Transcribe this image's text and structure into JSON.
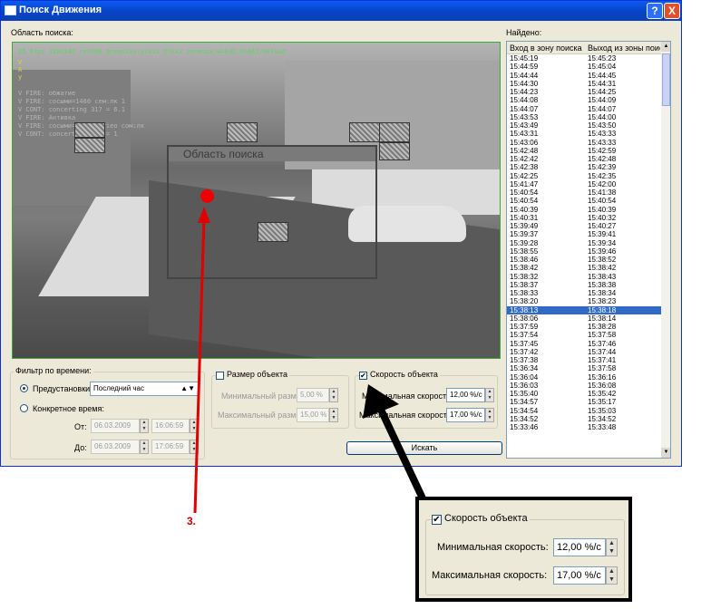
{
  "window": {
    "title": "Поиск Движения",
    "help": "?",
    "close": "X"
  },
  "search_area_label": "Область поиска:",
  "found_label": "Найдено:",
  "video": {
    "osd_top": "25.0fps 320x240 rot=90 area=xxx:y=xxx h=xxx zone=zx:w=632:h=462/deluxe",
    "osd_left": [
      "V",
      "A",
      "y",
      "",
      "V FIRE: обжатие",
      "V FIRE: сосыми=1460 сем:лк 1",
      "V CONT: concerting 317 = 6.1",
      "V FIRE: Антивка",
      "V FIRE: сосыми=6 eescerieo сом:лк",
      "V CONT: concerting 500 = 1"
    ],
    "zone_title": "Область поиска",
    "marker_number": "3."
  },
  "time_filter": {
    "title": "Фильтр по времени:",
    "presets_label": "Предустановки:",
    "presets_value": "Последний час",
    "specific_label": "Конкретное время:",
    "from_label": "От:",
    "to_label": "До:",
    "from_date": "06.03.2009",
    "from_time": "16:06:59",
    "to_date": "06.03.2009",
    "to_time": "17:06:59"
  },
  "size_filter": {
    "title": "Размер объекта",
    "min_label": "Минимальный размер:",
    "min_value": "5,00 %",
    "max_label": "Максимальный размер:",
    "max_value": "15,00 %"
  },
  "speed_filter": {
    "title": "Скорость объекта",
    "min_label": "Минимальная скорость:",
    "min_value": "12,00 %/с",
    "max_label": "Максимальная скорость:",
    "max_value": "17,00 %/с",
    "checked_glyph": "✔"
  },
  "search_button": "Искать",
  "results": {
    "col_enter": "Вход в зону поиска",
    "col_exit": "Выход из зоны поиск",
    "selected_index": 30,
    "rows": [
      [
        "15:45:19",
        "15:45:23"
      ],
      [
        "15:44:59",
        "15:45:04"
      ],
      [
        "15:44:44",
        "15:44:45"
      ],
      [
        "15:44:30",
        "15:44:31"
      ],
      [
        "15:44:23",
        "15:44:25"
      ],
      [
        "15:44:08",
        "15:44:09"
      ],
      [
        "15:44:07",
        "15:44:07"
      ],
      [
        "15:43:53",
        "15:44:00"
      ],
      [
        "15:43:49",
        "15:43:50"
      ],
      [
        "15:43:31",
        "15:43:33"
      ],
      [
        "15:43:06",
        "15:43:33"
      ],
      [
        "15:42:48",
        "15:42:59"
      ],
      [
        "15:42:42",
        "15:42:48"
      ],
      [
        "15:42:38",
        "15:42:39"
      ],
      [
        "15:42:25",
        "15:42:35"
      ],
      [
        "15:41:47",
        "15:42:00"
      ],
      [
        "15:40:54",
        "15:41:38"
      ],
      [
        "15:40:54",
        "15:40:54"
      ],
      [
        "15:40:39",
        "15:40:39"
      ],
      [
        "15:40:31",
        "15:40:32"
      ],
      [
        "15:39:49",
        "15:40:27"
      ],
      [
        "15:39:37",
        "15:39:41"
      ],
      [
        "15:39:28",
        "15:39:34"
      ],
      [
        "15:38:55",
        "15:39:46"
      ],
      [
        "15:38:46",
        "15:38:52"
      ],
      [
        "15:38:42",
        "15:38:42"
      ],
      [
        "15:38:32",
        "15:38:43"
      ],
      [
        "15:38:37",
        "15:38:38"
      ],
      [
        "15:38:33",
        "15:38:34"
      ],
      [
        "15:38:20",
        "15:38:23"
      ],
      [
        "15:38:13",
        "15:38:18"
      ],
      [
        "15:38:06",
        "15:38:14"
      ],
      [
        "15:37:59",
        "15:38:28"
      ],
      [
        "15:37:54",
        "15:37:58"
      ],
      [
        "15:37:45",
        "15:37:46"
      ],
      [
        "15:37:42",
        "15:37:44"
      ],
      [
        "15:37:38",
        "15:37:41"
      ],
      [
        "15:36:34",
        "15:37:58"
      ],
      [
        "15:36:04",
        "15:36:16"
      ],
      [
        "15:36:03",
        "15:36:08"
      ],
      [
        "15:35:40",
        "15:35:42"
      ],
      [
        "15:34:57",
        "15:35:17"
      ],
      [
        "15:34:54",
        "15:35:03"
      ],
      [
        "15:34:52",
        "15:34:52"
      ],
      [
        "15:33:46",
        "15:33:48"
      ]
    ]
  },
  "colors": {
    "accent": "#316ac5",
    "marker": "#ee0000",
    "title_bar": "#0a5bf2"
  }
}
